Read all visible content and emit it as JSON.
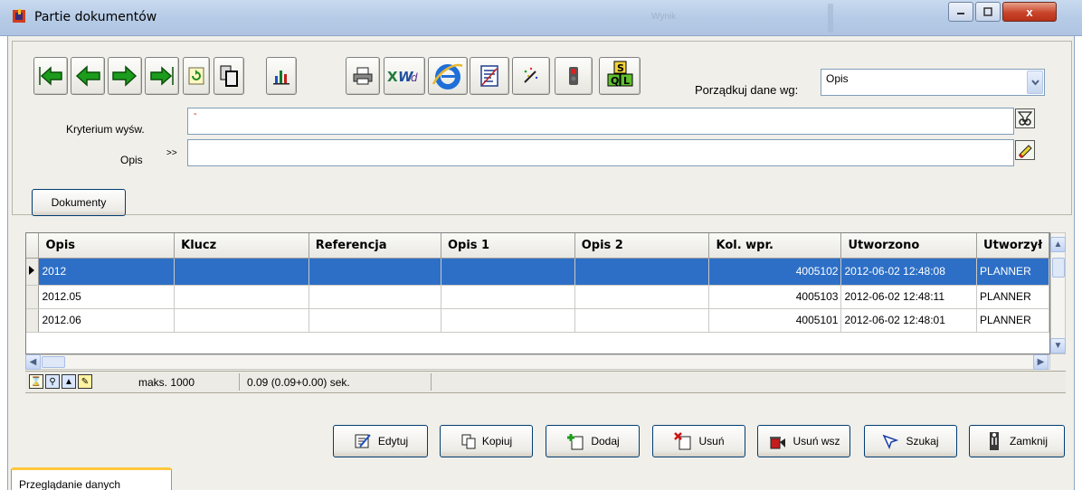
{
  "window": {
    "title": "Partie dokumentów",
    "background_title": "Wynik",
    "controls": {
      "minimize": "minimize-icon",
      "maximize": "maximize-icon",
      "close": "x"
    }
  },
  "toolbar": {
    "icons": [
      "first-record-icon",
      "previous-record-icon",
      "next-record-icon",
      "last-record-icon",
      "refresh-icon",
      "copy-pages-icon",
      "bar-chart-icon",
      "print-icon",
      "excel-word-export-icon",
      "internet-explorer-icon",
      "report-icon",
      "magic-wand-icon",
      "traffic-light-icon",
      "sql-blocks-icon"
    ],
    "sort_label": "Porządkuj dane wg:",
    "sort_value": "Opis"
  },
  "filters": {
    "criteria_label": "Kryterium wyśw.",
    "criteria_value": "-",
    "opis_label": "Opis",
    "opis_prefix": ">>",
    "opis_value": ""
  },
  "documents_button": "Dokumenty",
  "grid": {
    "columns": [
      "Opis",
      "Klucz",
      "Referencja",
      "Opis 1",
      "Opis 2",
      "Kol. wpr.",
      "Utworzono",
      "Utworzył"
    ],
    "rows": [
      {
        "opis": "2012",
        "klucz": "",
        "referencja": "",
        "opis1": "",
        "opis2": "",
        "kol_wpr": "4005102",
        "utworzono": "2012-06-02 12:48:08",
        "utworzyl": "PLANNER",
        "selected": true
      },
      {
        "opis": "2012.05",
        "klucz": "",
        "referencja": "",
        "opis1": "",
        "opis2": "",
        "kol_wpr": "4005103",
        "utworzono": "2012-06-02 12:48:11",
        "utworzyl": "PLANNER",
        "selected": false
      },
      {
        "opis": "2012.06",
        "klucz": "",
        "referencja": "",
        "opis1": "",
        "opis2": "",
        "kol_wpr": "4005101",
        "utworzono": "2012-06-02 12:48:01",
        "utworzyl": "PLANNER",
        "selected": false
      }
    ]
  },
  "status": {
    "max_label": "maks. 1000",
    "timing": "0.09 (0.09+0.00) sek."
  },
  "actions": {
    "edit": "Edytuj",
    "copy": "Kopiuj",
    "add": "Dodaj",
    "delete": "Usuń",
    "delete_all": "Usuń wsz",
    "search": "Szukaj",
    "close": "Zamknij"
  },
  "tab_label": "Przeglądanie danych",
  "colors": {
    "selection": "#2d6fc6",
    "titlebar": "#b6cbe6",
    "client": "#f0efe9"
  }
}
